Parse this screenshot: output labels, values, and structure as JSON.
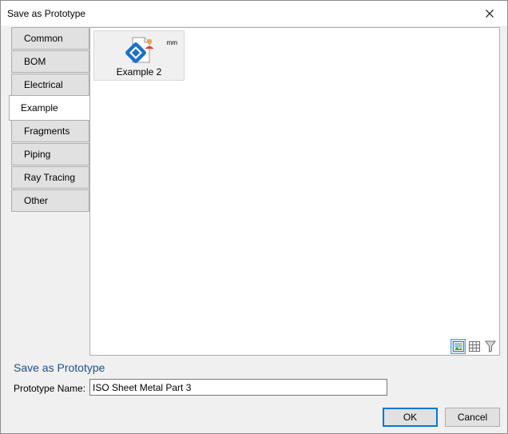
{
  "window": {
    "title": "Save as Prototype"
  },
  "tabs": [
    {
      "label": "Common",
      "selected": false
    },
    {
      "label": "BOM",
      "selected": false
    },
    {
      "label": "Electrical",
      "selected": false
    },
    {
      "label": "Example",
      "selected": true
    },
    {
      "label": "Fragments",
      "selected": false
    },
    {
      "label": "Piping",
      "selected": false
    },
    {
      "label": "Ray Tracing",
      "selected": false
    },
    {
      "label": "Other",
      "selected": false
    }
  ],
  "items": [
    {
      "label": "Example 2",
      "unit": "mm",
      "icon": "prototype-document-icon"
    }
  ],
  "view_buttons": [
    {
      "icon": "thumbnail-view-icon",
      "active": true
    },
    {
      "icon": "grid-view-icon",
      "active": false
    },
    {
      "icon": "filter-icon",
      "active": false
    }
  ],
  "form": {
    "section_title": "Save as Prototype",
    "name_label": "Prototype Name:",
    "name_value": "ISO Sheet Metal Part 3"
  },
  "buttons": {
    "ok": "OK",
    "cancel": "Cancel"
  },
  "colors": {
    "accent": "#0078d7",
    "section_title": "#1e4f8c"
  }
}
